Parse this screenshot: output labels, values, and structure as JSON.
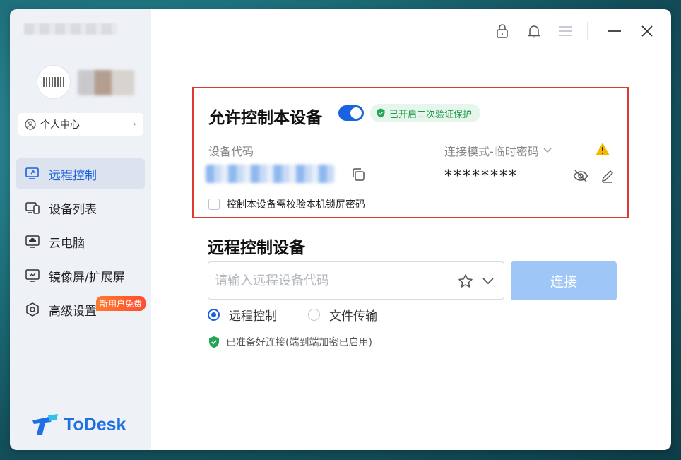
{
  "sidebar": {
    "profile_center": "个人中心",
    "items": [
      {
        "label": "远程控制",
        "icon": "remote-control-icon",
        "active": true
      },
      {
        "label": "设备列表",
        "icon": "device-list-icon",
        "active": false
      },
      {
        "label": "云电脑",
        "icon": "cloud-pc-icon",
        "active": false,
        "badge": "新用户免费"
      },
      {
        "label": "镜像屏/扩展屏",
        "icon": "mirror-screen-icon",
        "active": false
      },
      {
        "label": "高级设置",
        "icon": "settings-hexagon-icon",
        "active": false
      }
    ],
    "logo_text": "ToDesk"
  },
  "allow_control": {
    "title": "允许控制本设备",
    "enabled": true,
    "verify_badge": "已开启二次验证保护",
    "device_code_label": "设备代码",
    "connection_mode": "连接模式-临时密码",
    "password": "********",
    "lock_screen_check": "控制本设备需校验本机锁屏密码"
  },
  "remote": {
    "title": "远程控制设备",
    "input_placeholder": "请输入远程设备代码",
    "connect_label": "连接",
    "modes": [
      {
        "label": "远程控制",
        "checked": true
      },
      {
        "label": "文件传输",
        "checked": false
      }
    ],
    "status": "已准备好连接(端到端加密已启用)"
  },
  "colors": {
    "accent": "#1a63e0",
    "highlight_border": "#e03a30",
    "connect_button": "#9ec6f7",
    "badge_green": "#1f9a4a",
    "promo_orange": "#ff5a2f"
  }
}
